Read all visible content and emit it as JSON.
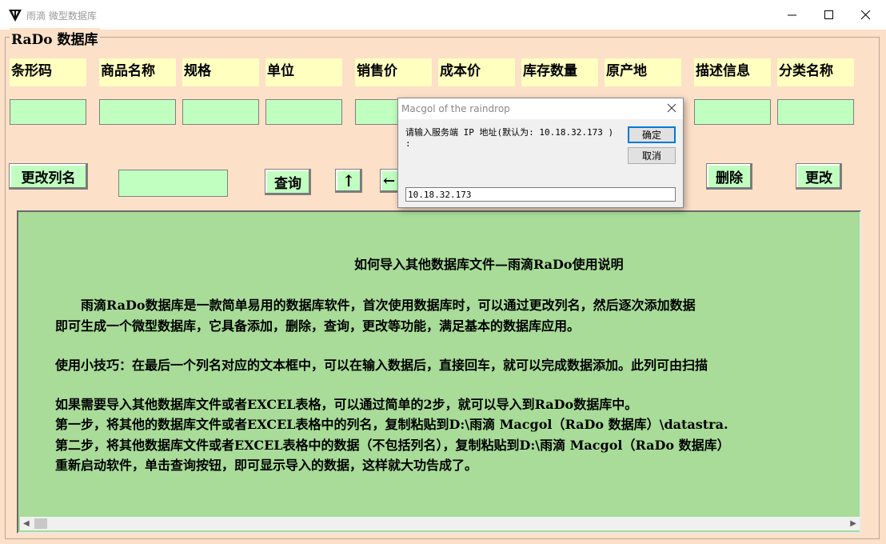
{
  "window": {
    "title": "雨滴 微型数据库",
    "group_label": "RaDo 数据库"
  },
  "columns": [
    {
      "name": "条形码"
    },
    {
      "name": "商品名称"
    },
    {
      "name": "规格"
    },
    {
      "name": "单位"
    },
    {
      "name": "销售价"
    },
    {
      "name": "成本价"
    },
    {
      "name": "库存数量"
    },
    {
      "name": "原产地"
    },
    {
      "name": "描述信息"
    },
    {
      "name": "分类名称"
    }
  ],
  "toolbar": {
    "rename_label": "更改列名",
    "query_label": "查询",
    "up_label": "↑",
    "left_label": "←",
    "delete_label": "删除",
    "modify_label": "更改"
  },
  "memo": {
    "title": "如何导入其他数据库文件—雨滴RaDo使用说明",
    "lines": [
      "　　雨滴RaDo数据库是一款简单易用的数据库软件，首次使用数据库时，可以通过更改列名，然后逐次添加数据",
      "即可生成一个微型数据库，它具备添加，删除，查询，更改等功能，满足基本的数据库应用。",
      "使用小技巧：在最后一个列名对应的文本框中，可以在输入数据后，直接回车，就可以完成数据添加。此列可由扫描",
      "如果需要导入其他数据库文件或者EXCEL表格，可以通过简单的2步，就可以导入到RaDo数据库中。",
      "第一步，将其他的数据库文件或者EXCEL表格中的列名，复制粘贴到D:\\雨滴 Macgol（RaDo 数据库）\\datastra.",
      "第二步，将其他数据库文件或者EXCEL表格中的数据（不包括列名），复制粘贴到D:\\雨滴 Macgol（RaDo 数据库）",
      "重新启动软件，单击查询按钮，即可显示导入的数据，这样就大功告成了。"
    ]
  },
  "dialog": {
    "title": "Macgol of the raindrop",
    "prompt": "请输入服务端 IP 地址(默认为: 10.18.32.173 ) :",
    "ok_label": "确定",
    "cancel_label": "取消",
    "input_value": "10.18.32.173"
  }
}
